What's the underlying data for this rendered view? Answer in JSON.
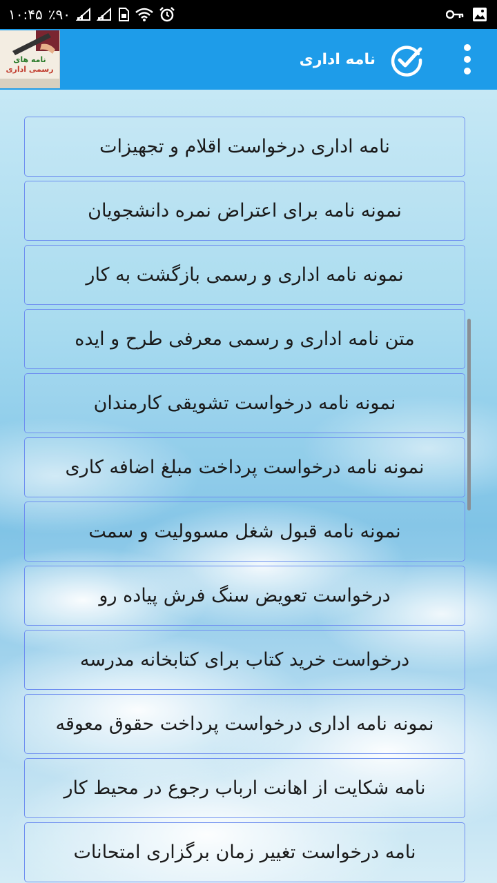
{
  "status_bar": {
    "time": "۱۰:۴۵",
    "battery": "٪۹۰",
    "icons": [
      "signal-icon",
      "signal-icon",
      "sim-icon",
      "wifi-icon",
      "alarm-icon",
      "key-icon",
      "image-icon"
    ]
  },
  "app_bar": {
    "title": "نامه اداری",
    "logo_line1": "نامه های",
    "logo_line2": "رسمی اداری",
    "icons": [
      "app-logo",
      "check-circle-icon",
      "more-vert-icon"
    ]
  },
  "colors": {
    "app_bar": "#1e9ce9",
    "item_border": "#6f8ff0"
  },
  "list": {
    "items": [
      "نامه اداری درخواست اقلام و تجهیزات",
      "نمونه نامه برای اعتراض نمره دانشجویان",
      "نمونه نامه اداری و رسمی بازگشت به کار",
      "متن نامه اداری و رسمی معرفی طرح و ایده",
      "نمونه نامه درخواست تشویقی کارمندان",
      "نمونه نامه درخواست پرداخت مبلغ اضافه کاری",
      "نمونه نامه قبول شغل مسوولیت و سمت",
      "درخواست تعویض سنگ فرش پیاده رو",
      "درخواست خرید کتاب برای کتابخانه مدرسه",
      "نمونه نامه اداری درخواست پرداخت حقوق معوقه",
      "نامه شکایت از اهانت ارباب رجوع در محیط کار",
      "نامه درخواست تغییر زمان برگزاری امتحانات"
    ]
  }
}
